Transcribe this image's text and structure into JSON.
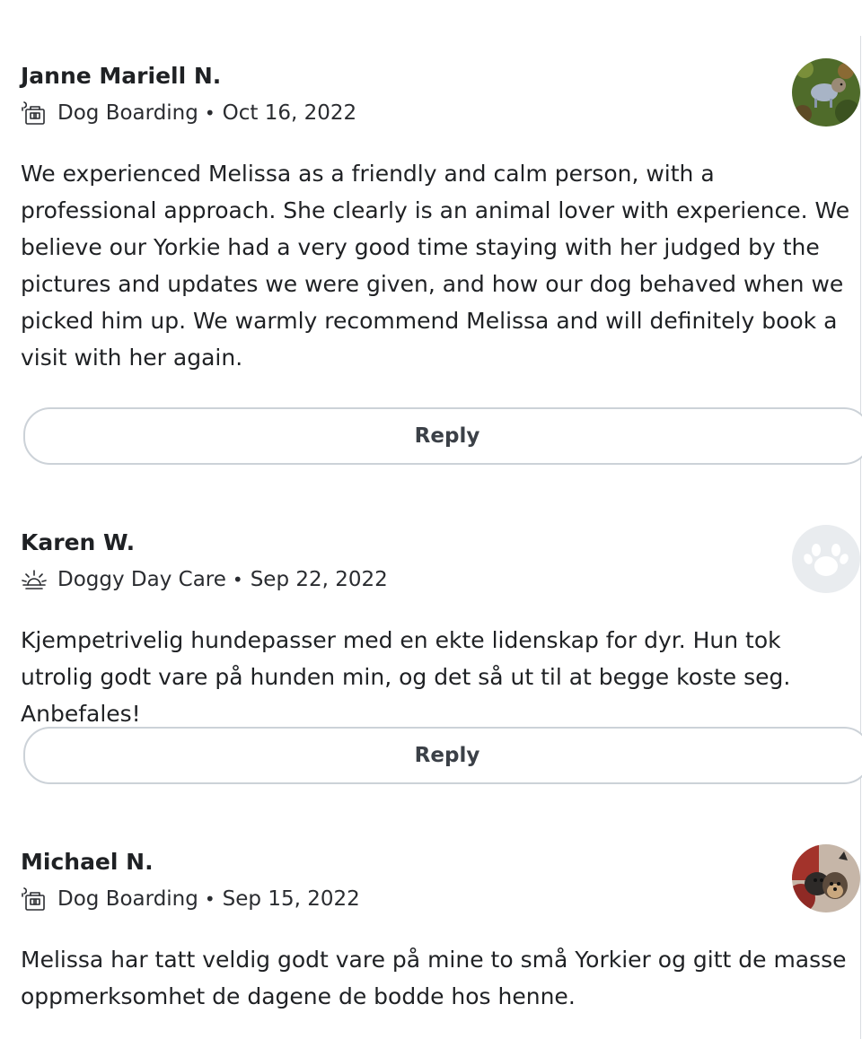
{
  "reviews": [
    {
      "name": "Janne Mariell N.",
      "service_icon": "dog-boarding-icon",
      "service": "Dog Boarding",
      "separator": "•",
      "date": "Oct 16, 2022",
      "avatar": "photo-avatar",
      "text": "We experienced Melissa as a friendly and calm person, with a professional approach. She clearly is an animal lover with experience. We believe our Yorkie had a very good time staying with her judged by the pictures and updates we were given, and how our dog behaved when we picked him up. We warmly recommend Melissa and will definitely book a visit with her again.",
      "reply_label": "Reply"
    },
    {
      "name": "Karen W.",
      "service_icon": "doggy-day-care-icon",
      "service": "Doggy Day Care",
      "separator": "•",
      "date": "Sep 22, 2022",
      "avatar": "paw-placeholder-avatar",
      "text": "Kjempetrivelig hundepasser med en ekte lidenskap for dyr. Hun tok utrolig godt vare på hunden min, og det så ut til at begge koste seg. Anbefales!",
      "reply_label": "Reply"
    },
    {
      "name": "Michael N.",
      "service_icon": "dog-boarding-icon",
      "service": "Dog Boarding",
      "separator": "•",
      "date": "Sep 15, 2022",
      "avatar": "photo-avatar",
      "text": "Melissa har tatt veldig godt vare på mine to små Yorkier og gitt de masse oppmerksomhet de dagene de bodde hos henne."
    }
  ],
  "colors": {
    "text": "#1f2124",
    "button_border": "#ccd2d8",
    "placeholder_bg": "#e9ecef",
    "placeholder_paw": "#ffffff"
  }
}
